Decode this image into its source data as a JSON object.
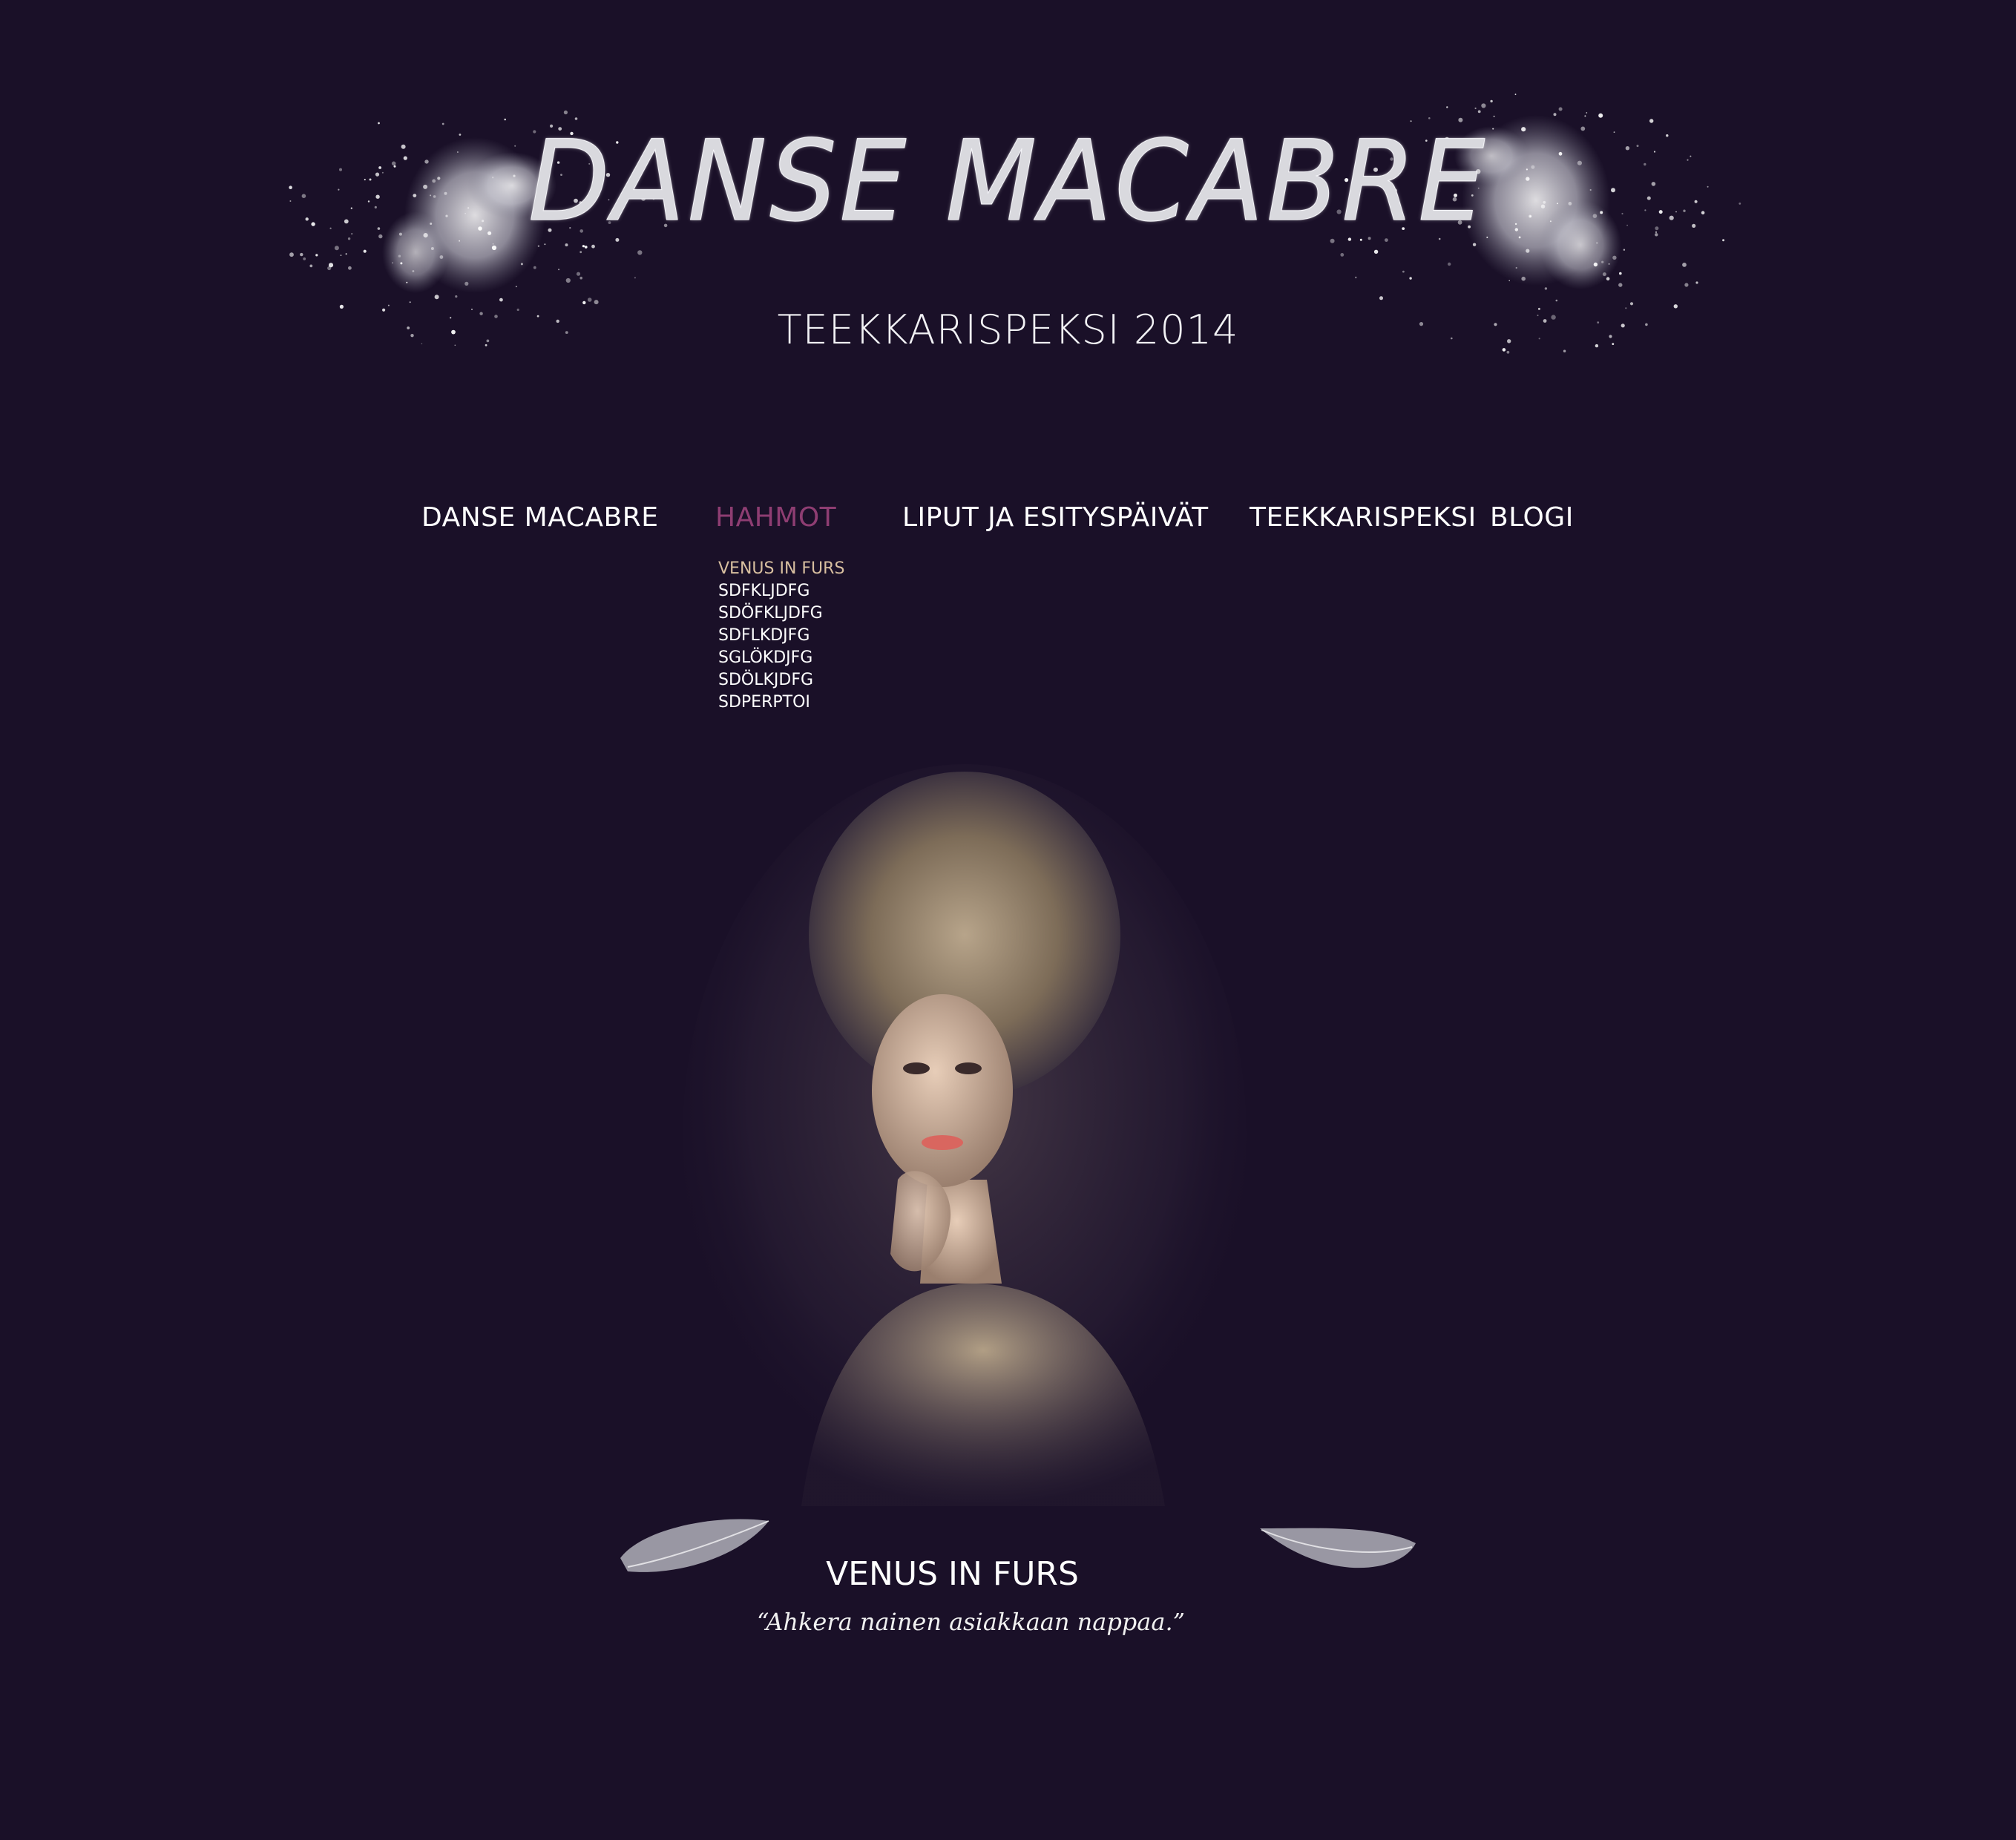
{
  "colors": {
    "background": "#1a1028",
    "nav_active": "#8e3d72",
    "submenu_selected": "#d8bfa0",
    "text": "#ffffff"
  },
  "header": {
    "title": "DANSE MACABRE",
    "subtitle": "TEEKKARISPEKSI 2014"
  },
  "nav": {
    "items": [
      {
        "label": "DANSE MACABRE"
      },
      {
        "label": "HAHMOT"
      },
      {
        "label": "LIPUT JA ESITYSPÄIVÄT"
      },
      {
        "label": "TEEKKARISPEKSI"
      },
      {
        "label": "BLOGI"
      }
    ]
  },
  "submenu": {
    "items": [
      {
        "label": "VENUS IN FURS"
      },
      {
        "label": "SDFKLJDFG"
      },
      {
        "label": "SDÖFKLJDFG"
      },
      {
        "label": "SDFLKDJFG"
      },
      {
        "label": "SGLÖKDJFG"
      },
      {
        "label": "SDÖLKJDFG"
      },
      {
        "label": "SDPERPTOI"
      }
    ]
  },
  "character": {
    "name": "VENUS IN FURS",
    "quote": "“Ahkera nainen asiakkaan nappaa.”"
  }
}
